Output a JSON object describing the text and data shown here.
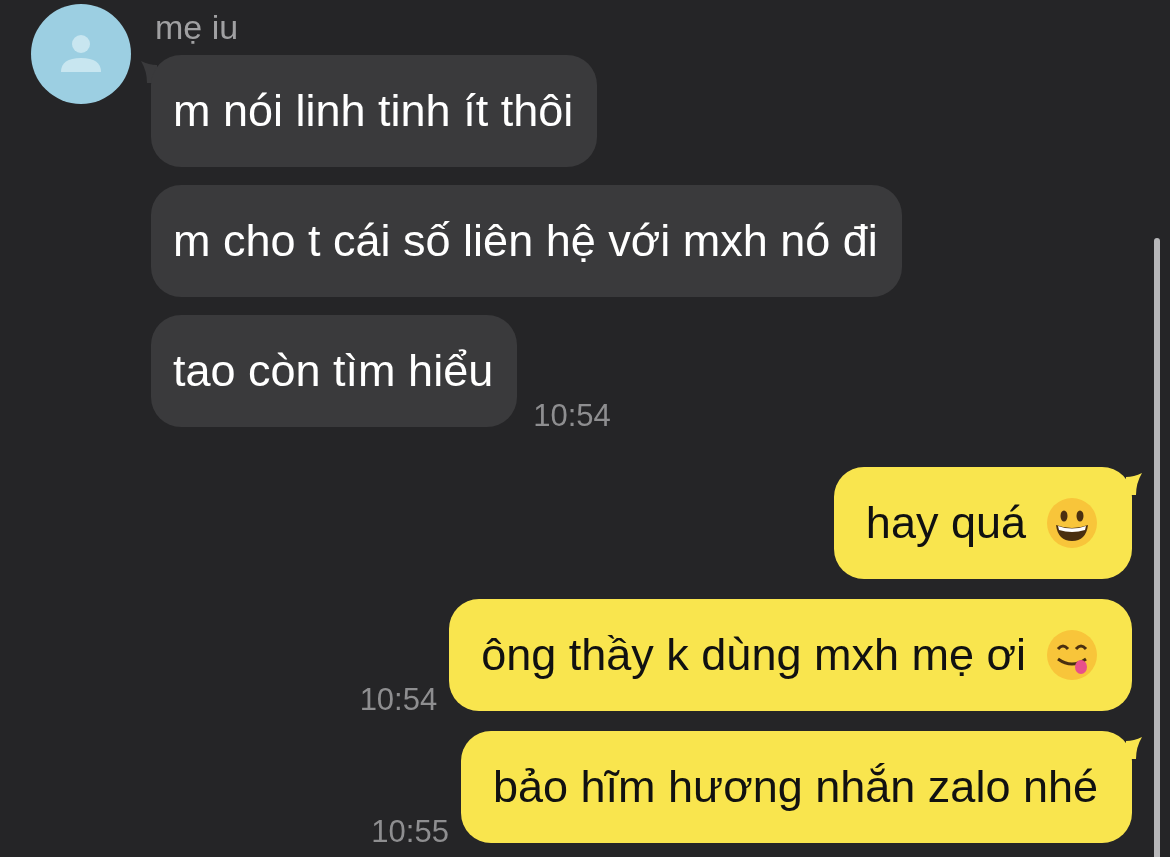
{
  "contact": {
    "name": "mẹ iu"
  },
  "groups": [
    {
      "kind": "incoming",
      "messages": [
        {
          "text": "m nói linh tinh ít thôi",
          "tail": true
        },
        {
          "text": "m cho t cái số liên hệ với mxh nó đi",
          "tail": false
        },
        {
          "text": "tao còn tìm hiểu",
          "tail": false,
          "time": "10:54"
        }
      ]
    },
    {
      "kind": "outgoing",
      "messages": [
        {
          "text": "hay quá",
          "tail": true,
          "emoji": {
            "kind": "grin"
          }
        },
        {
          "text": "ông thầy k dùng mxh mẹ ơi",
          "tail": false,
          "emoji": {
            "kind": "yum"
          },
          "time": "10:54"
        },
        {
          "text": "bảo hĩm hương nhắn zalo nhé",
          "tail": true,
          "time": "10:55"
        }
      ]
    }
  ]
}
